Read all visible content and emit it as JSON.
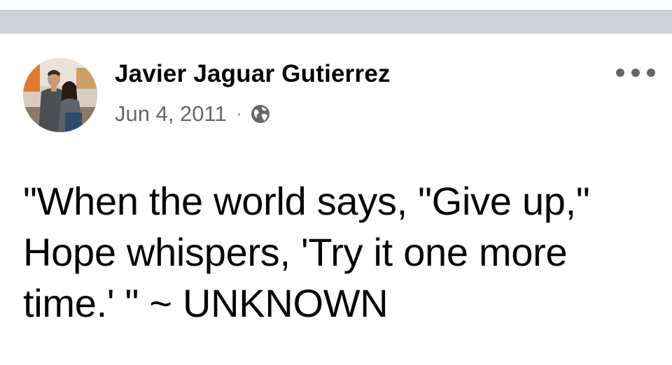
{
  "post": {
    "author_name": "Javier Jaguar Gutierrez",
    "date": "Jun 4, 2011",
    "separator": "·",
    "privacy_icon": "globe-icon",
    "more_icon": "more-options-icon",
    "text": "\"When the world says, \"Give up,\" Hope whispers, 'Try it one more time.' \" ~ UNKNOWN"
  },
  "colors": {
    "name": "#050505",
    "meta": "#65676b",
    "divider": "#cfd2d6",
    "background": "#ffffff"
  }
}
